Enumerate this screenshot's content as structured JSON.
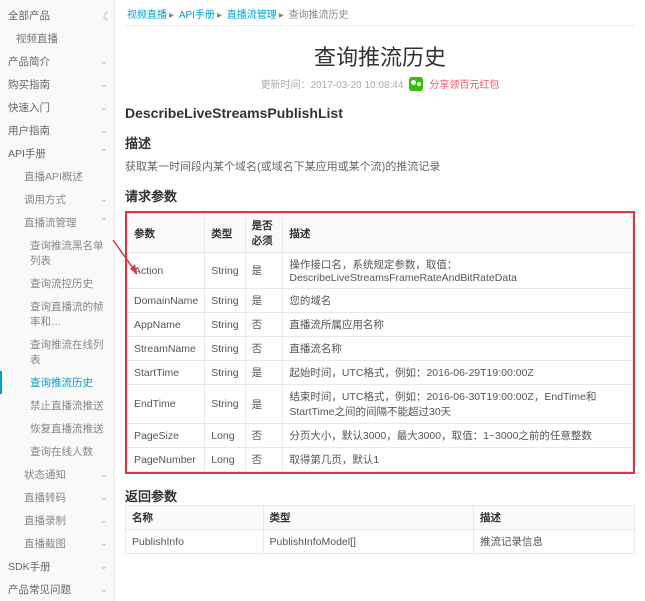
{
  "sidebar": {
    "all_products": "全部产品",
    "items": [
      {
        "label": "视频直播",
        "kind": "sub",
        "chev": ""
      },
      {
        "label": "产品简介",
        "kind": "head",
        "chev": "⌄"
      },
      {
        "label": "购买指南",
        "kind": "head",
        "chev": "⌄"
      },
      {
        "label": "快速入门",
        "kind": "head",
        "chev": "⌄"
      },
      {
        "label": "用户指南",
        "kind": "head",
        "chev": "⌄"
      },
      {
        "label": "API手册",
        "kind": "head",
        "chev": "⌃"
      },
      {
        "label": "直播API概述",
        "kind": "sub2",
        "chev": ""
      },
      {
        "label": "调用方式",
        "kind": "sub2",
        "chev": "⌄"
      },
      {
        "label": "直播流管理",
        "kind": "sub2",
        "chev": "⌃"
      },
      {
        "label": "查询推流黑名单列表",
        "kind": "sub3",
        "chev": ""
      },
      {
        "label": "查询流控历史",
        "kind": "sub3",
        "chev": ""
      },
      {
        "label": "查询直播流的帧率和…",
        "kind": "sub3",
        "chev": ""
      },
      {
        "label": "查询推流在线列表",
        "kind": "sub3",
        "chev": ""
      },
      {
        "label": "查询推流历史",
        "kind": "sub3 active",
        "chev": ""
      },
      {
        "label": "禁止直播流推送",
        "kind": "sub3",
        "chev": ""
      },
      {
        "label": "恢复直播流推送",
        "kind": "sub3",
        "chev": ""
      },
      {
        "label": "查询在线人数",
        "kind": "sub3",
        "chev": ""
      },
      {
        "label": "状态通知",
        "kind": "sub2",
        "chev": "⌄"
      },
      {
        "label": "直播转码",
        "kind": "sub2",
        "chev": "⌄"
      },
      {
        "label": "直播录制",
        "kind": "sub2",
        "chev": "⌄"
      },
      {
        "label": "直播截图",
        "kind": "sub2",
        "chev": "⌄"
      },
      {
        "label": "SDK手册",
        "kind": "head",
        "chev": "⌄"
      },
      {
        "label": "产品常见问题",
        "kind": "head",
        "chev": "⌄"
      }
    ]
  },
  "breadcrumb": {
    "a": "视频直播",
    "b": "API手册",
    "c": "直播流管理",
    "d": "查询推流历史"
  },
  "page": {
    "title": "查询推流历史",
    "updated_label": "更新时间：",
    "updated": "2017-03-20 10:08:44",
    "share": "分享领百元红包"
  },
  "api_name": "DescribeLiveStreamsPublishList",
  "sections": {
    "desc_h": "描述",
    "desc_body": "获取某一时间段内某个域名(或域名下某应用或某个流)的推流记录",
    "req_h": "请求参数",
    "resp_h": "返回参数"
  },
  "req_header": {
    "c0": "参数",
    "c1": "类型",
    "c2": "是否必须",
    "c3": "描述"
  },
  "chart_data": {
    "type": "table",
    "columns": [
      "参数",
      "类型",
      "是否必须",
      "描述"
    ],
    "rows": [
      [
        "Action",
        "String",
        "是",
        "操作接口名，系统规定参数，取值：DescribeLiveStreamsFrameRateAndBitRateData"
      ],
      [
        "DomainName",
        "String",
        "是",
        "您的域名"
      ],
      [
        "AppName",
        "String",
        "否",
        "直播流所属应用名称"
      ],
      [
        "StreamName",
        "String",
        "否",
        "直播流名称"
      ],
      [
        "StartTime",
        "String",
        "是",
        "起始时间，UTC格式，例如：2016-06-29T19:00:00Z"
      ],
      [
        "EndTime",
        "String",
        "是",
        "结束时间，UTC格式，例如：2016-06-30T19:00:00Z，EndTime和StartTime之间的间隔不能超过30天"
      ],
      [
        "PageSize",
        "Long",
        "否",
        "分页大小，默认3000，最大3000，取值：1~3000之前的任意整数"
      ],
      [
        "PageNumber",
        "Long",
        "否",
        "取得第几页，默认1"
      ]
    ]
  },
  "resp_header": {
    "c0": "名称",
    "c1": "类型",
    "c2": "描述"
  },
  "resp_rows": [
    [
      "PublishInfo",
      "PublishInfoModel[]",
      "推流记录信息"
    ]
  ]
}
